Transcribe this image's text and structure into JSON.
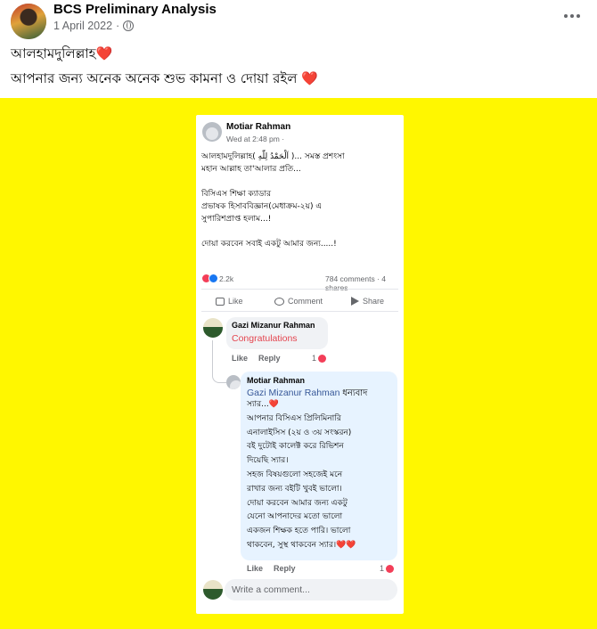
{
  "post": {
    "page_name": "BCS Preliminary Analysis",
    "date": "1 April 2022",
    "separator": "·",
    "line1": "আলহামদুলিল্লাহ",
    "line1_emoji": "❤️",
    "line2": "আপনার জন্য অনেক অনেক শুভ কামনা ও দোয়া রইল",
    "line2_emoji": "❤️"
  },
  "screenshot": {
    "author": "Motiar Rahman",
    "time": "Wed at 2:48 pm ·",
    "body": "আলহামদুলিল্লাহ( اَلْحَمْدُ لِلّٰهِ )... সমস্ত প্রশংসা\nমহান আল্লাহ তা'আলার প্রতি...\n\nবিসিএস শিক্ষা ক্যাডার\nপ্রভাষক হিসাববিজ্ঞান(মেধাক্রম-২য়) এ\nসুপারিশপ্রাপ্ত হলাম...!\n\nদোয়া করবেন সবাই একটু আমার জন্য.....!",
    "reaction_count": "2.2k",
    "comments_shares": "784 comments · 4 shares",
    "actions": {
      "like": "Like",
      "comment": "Comment",
      "share": "Share"
    },
    "comment1": {
      "name": "Gazi Mizanur Rahman",
      "text": "Congratulations",
      "like": "Like",
      "reply": "Reply",
      "reactions": "1"
    },
    "comment2": {
      "name": "Motiar Rahman",
      "tag": "Gazi Mizanur Rahman",
      "text_after_tag": " ধন্যবাদ",
      "body": "স্যার...❤️\nআপনার বিসিএস প্রিলিমিনারি\nএনালাইসিস (২য় ও ৩য় সংস্করন)\nবই দুটোই কালেক্ট করে রিভিশন\nদিয়েছি স্যার।\nসহজ বিষয়গুলো সহজেই মনে\nরাখার জন্য বইটি খুবই ভালো।\nদোয়া করবেন আমার জন্য একটু\nযেনো আপনাদের মতো ভালো\nএকজন শিক্ষক হতে পারি। ভালো\nথাকবেন, সুস্থ থাকবেন স্যার।❤️❤️",
      "like": "Like",
      "reply": "Reply",
      "reactions": "1"
    },
    "write_placeholder": "Write a comment..."
  },
  "colors": {
    "background": "#fff700",
    "reaction_red": "#f33e58",
    "link_blue": "#385898",
    "muted": "#65676b"
  }
}
